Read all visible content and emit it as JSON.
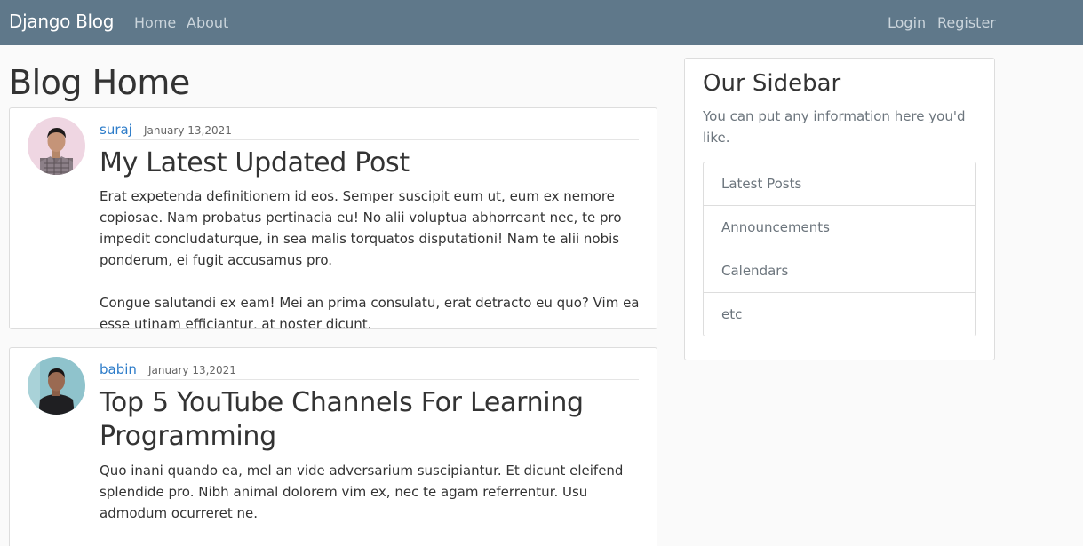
{
  "navbar": {
    "brand": "Django Blog",
    "links": [
      "Home",
      "About"
    ],
    "auth_links": [
      "Login",
      "Register"
    ]
  },
  "main": {
    "title": "Blog Home",
    "posts": [
      {
        "author": "suraj",
        "date": "January 13,2021",
        "title": "My Latest Updated Post",
        "paragraphs": [
          "Erat expetenda definitionem id eos. Semper suscipit eum ut, eum ex nemore copiosae. Nam probatus pertinacia eu! No alii voluptua abhorreant nec, te pro impedit concludaturque, in sea malis torquatos disputationi! Nam te alii nobis ponderum, ei fugit accusamus pro.",
          "Congue salutandi ex eam! Mei an prima consulatu, erat detracto eu quo? Vim ea esse utinam efficiantur, at noster dicunt."
        ]
      },
      {
        "author": "babin",
        "date": "January 13,2021",
        "title_line1": "Top 5 YouTube Channels For Learning",
        "title_line2": "Programming",
        "paragraphs": [
          "Quo inani quando ea, mel an vide adversarium suscipiantur. Et dicunt eleifend splendide pro. Nibh animal dolorem vim ex, nec te agam referrentur. Usu admodum ocurreret ne."
        ]
      }
    ]
  },
  "sidebar": {
    "title": "Our Sidebar",
    "text": "You can put any information here you'd like.",
    "items": [
      "Latest Posts",
      "Announcements",
      "Calendars",
      "etc"
    ]
  },
  "colors": {
    "navbar": "#5f788a",
    "link": "#2d7cc9",
    "muted": "#6c757d"
  }
}
